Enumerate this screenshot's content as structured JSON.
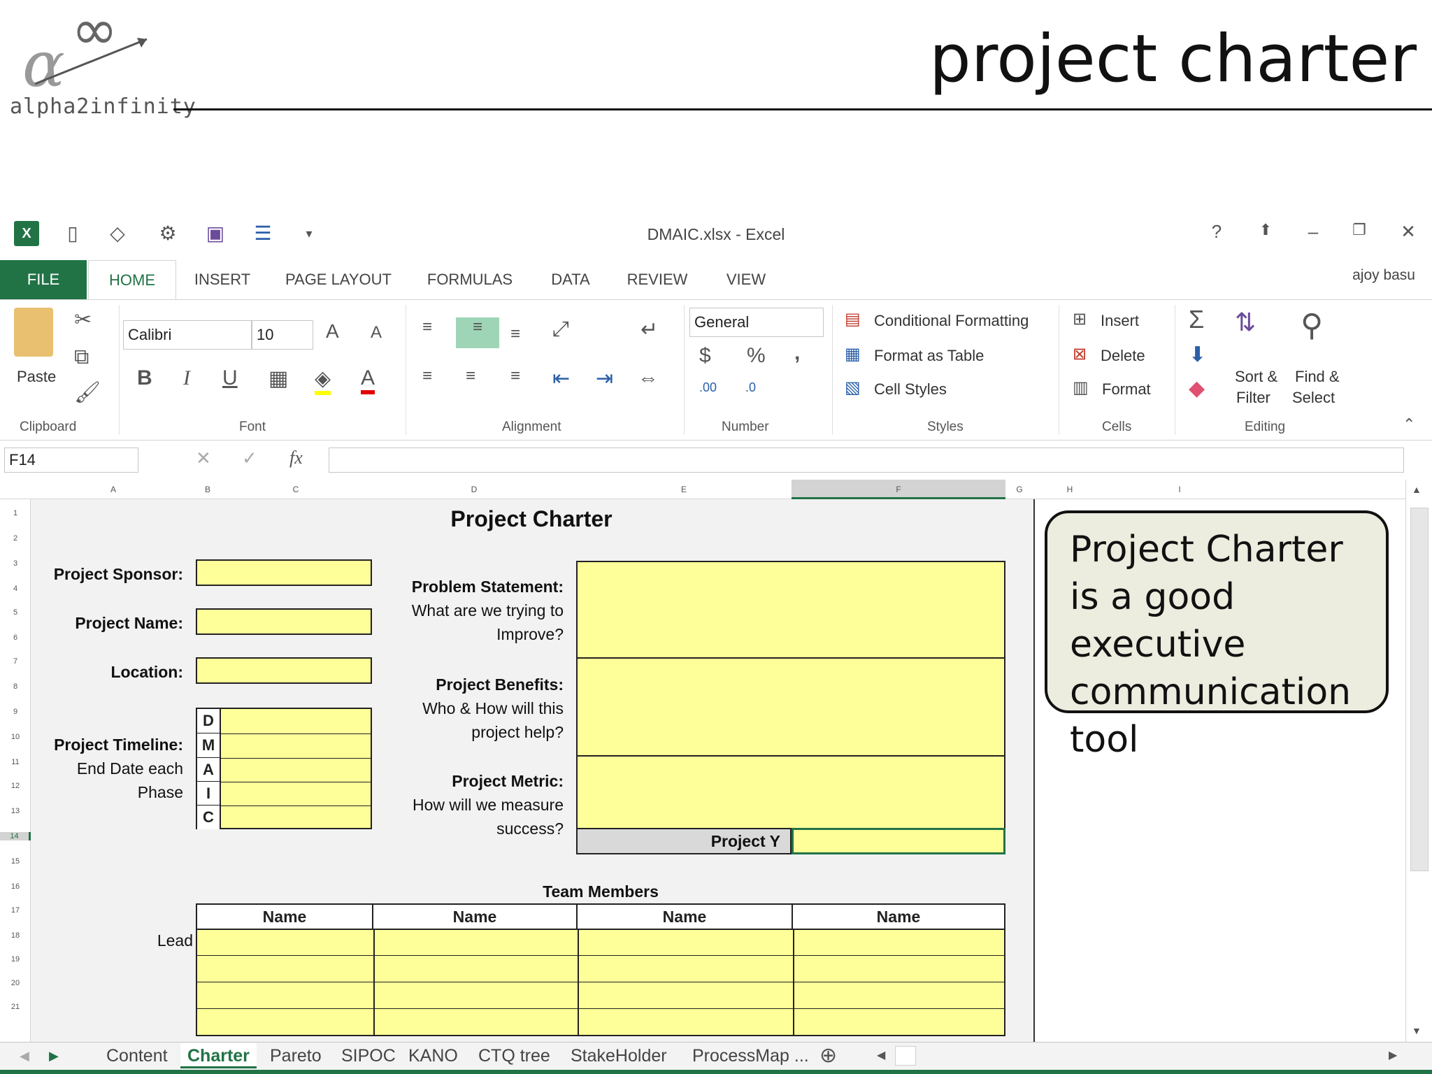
{
  "slide": {
    "logo_text": "alpha2infinity",
    "title": "project charter"
  },
  "window": {
    "title": "DMAIC.xlsx - Excel",
    "help": "?",
    "minimize": "–",
    "close": "✕"
  },
  "ribbon_tabs": [
    "FILE",
    "HOME",
    "INSERT",
    "PAGE LAYOUT",
    "FORMULAS",
    "DATA",
    "REVIEW",
    "VIEW"
  ],
  "user": "ajoy basu",
  "clipboard": {
    "paste": "Paste",
    "label": "Clipboard"
  },
  "font": {
    "name": "Calibri",
    "size": "10",
    "bold": "B",
    "italic": "I",
    "underline": "U",
    "grow": "A",
    "shrink": "A",
    "color": "A",
    "label": "Font"
  },
  "alignment": {
    "label": "Alignment"
  },
  "number": {
    "format": "General",
    "currency": "$",
    "percent": "%",
    "comma": ",",
    "inc": ".00",
    "dec": ".0",
    "label": "Number"
  },
  "styles": {
    "cond": "Conditional Formatting",
    "table": "Format as Table",
    "cell": "Cell Styles",
    "label": "Styles"
  },
  "cells": {
    "insert": "Insert",
    "delete": "Delete",
    "format": "Format",
    "label": "Cells"
  },
  "editing": {
    "sigma": "Σ",
    "sort1": "Sort &",
    "sort2": "Filter",
    "find1": "Find &",
    "find2": "Select",
    "label": "Editing"
  },
  "formula_bar": {
    "name_box": "F14",
    "fx": "fx",
    "cancel": "✕",
    "enter": "✓"
  },
  "columns": [
    "A",
    "B",
    "C",
    "D",
    "E",
    "F",
    "G",
    "H",
    "I"
  ],
  "rows": [
    "1",
    "2",
    "3",
    "4",
    "5",
    "6",
    "7",
    "8",
    "9",
    "10",
    "11",
    "12",
    "13",
    "14",
    "15",
    "16",
    "17",
    "18",
    "19",
    "20",
    "21"
  ],
  "charter": {
    "title": "Project Charter",
    "sponsor": "Project Sponsor:",
    "name": "Project Name:",
    "location": "Location:",
    "timeline": "Project Timeline:",
    "timeline_sub1": "End Date each",
    "timeline_sub2": "Phase",
    "phases": [
      "D",
      "M",
      "A",
      "I",
      "C"
    ],
    "problem": "Problem Statement:",
    "problem_sub1": "What are we trying to",
    "problem_sub2": "Improve?",
    "benefits": "Project Benefits:",
    "benefits_sub1": "Who & How will this",
    "benefits_sub2": "project help?",
    "metric": "Project Metric:",
    "metric_sub1": "How will we measure",
    "metric_sub2": "success?",
    "project_y": "Project Y",
    "team_title": "Team Members",
    "team_headers": [
      "Name",
      "Name",
      "Name",
      "Name"
    ],
    "lead": "Lead"
  },
  "callout": "Project Charter is a good executive communication tool",
  "sheet_tabs": [
    "Content",
    "Charter",
    "Pareto",
    "SIPOC",
    "KANO",
    "CTQ tree",
    "StakeHolder",
    "ProcessMap ..."
  ],
  "active_sheet": "Charter",
  "colors": {
    "excel_green": "#217346",
    "cell_yellow": "#ffff99",
    "callout_bg": "#ececdf"
  }
}
